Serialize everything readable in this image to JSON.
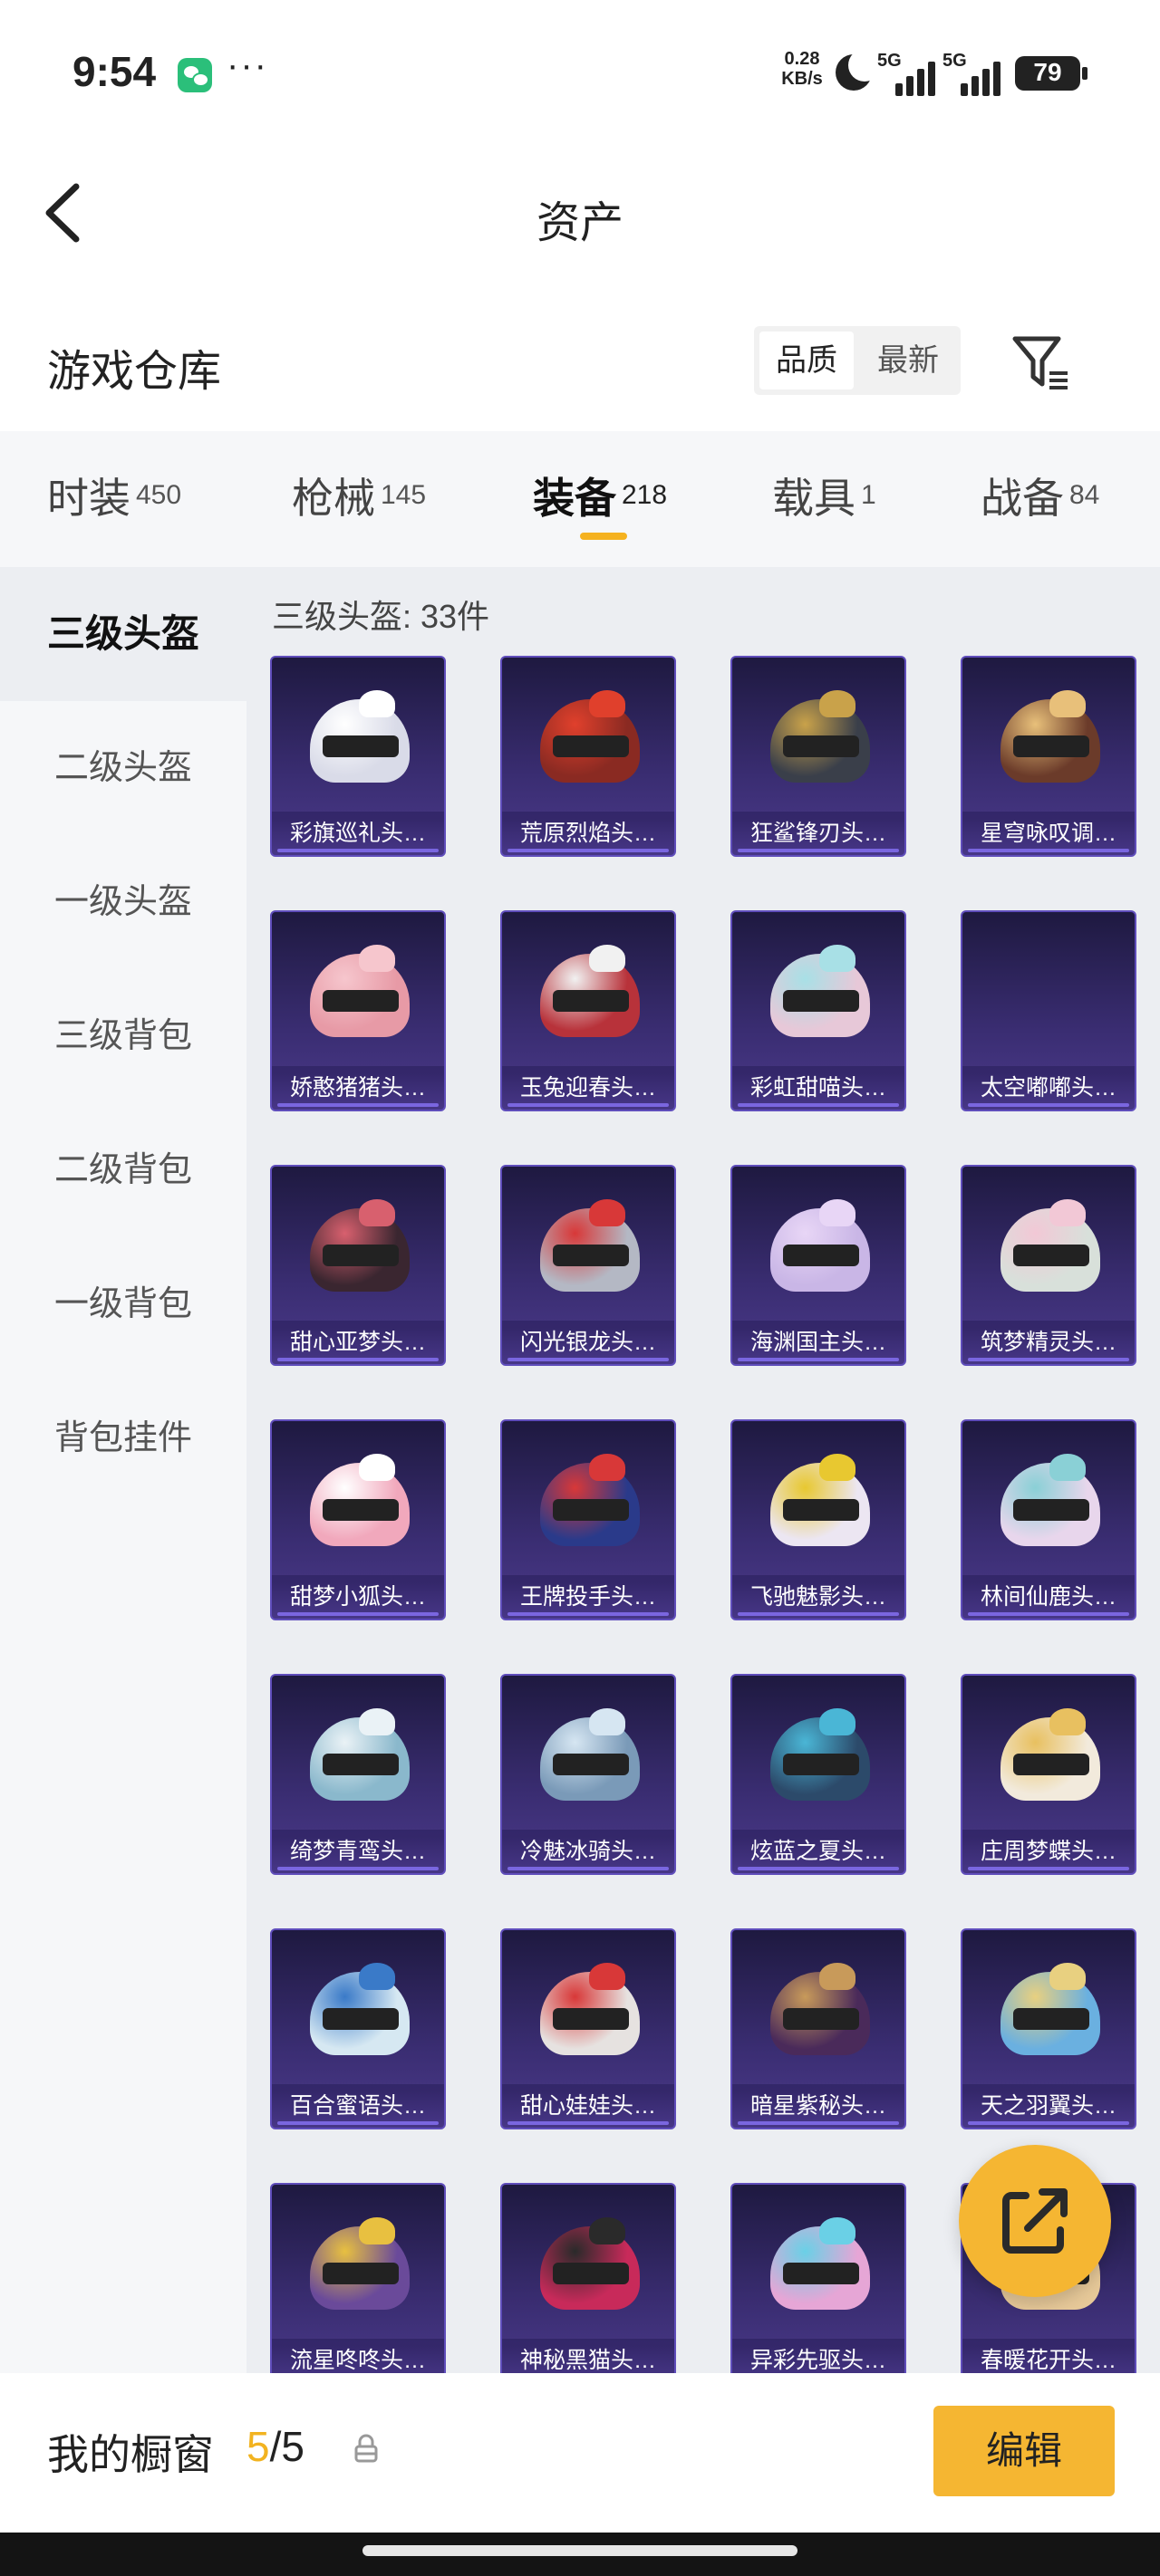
{
  "status_bar": {
    "time": "9:54",
    "more": "···",
    "net_speed_value": "0.28",
    "net_speed_unit": "KB/s",
    "signal1": "5G",
    "signal2": "5G",
    "battery": "79"
  },
  "nav": {
    "title": "资产"
  },
  "header": {
    "title": "游戏仓库",
    "sort_options": [
      "品质",
      "最新"
    ],
    "active_sort": "品质"
  },
  "tabs": [
    {
      "label": "时装",
      "count": "450"
    },
    {
      "label": "枪械",
      "count": "145"
    },
    {
      "label": "装备",
      "count": "218"
    },
    {
      "label": "载具",
      "count": "1"
    },
    {
      "label": "战备",
      "count": "84"
    }
  ],
  "active_tab": "装备",
  "sidebar": [
    {
      "label": "三级头盔"
    },
    {
      "label": "二级头盔"
    },
    {
      "label": "一级头盔"
    },
    {
      "label": "三级背包"
    },
    {
      "label": "二级背包"
    },
    {
      "label": "一级背包"
    },
    {
      "label": "背包挂件"
    }
  ],
  "category_count": "三级头盔: 33件",
  "items": [
    {
      "name": "彩旗巡礼头…",
      "color": "#d9dbe8",
      "accent": "#ffffff"
    },
    {
      "name": "荒原烈焰头…",
      "color": "#8a2a22",
      "accent": "#e0402c"
    },
    {
      "name": "狂鲨锋刃头…",
      "color": "#3a3f4a",
      "accent": "#c9a24a"
    },
    {
      "name": "星穹咏叹调…",
      "color": "#6b3b2a",
      "accent": "#e8c07a"
    },
    {
      "name": "娇憨猪猪头…",
      "color": "#e79aa6",
      "accent": "#f6c6cd"
    },
    {
      "name": "玉兔迎春头…",
      "color": "#b8323a",
      "accent": "#f1f1f1"
    },
    {
      "name": "彩虹甜喵头…",
      "color": "#e7c8d8",
      "accent": "#a8e0e6"
    },
    {
      "name": "太空嘟嘟头…",
      "color": "#2a2550",
      "accent": "#2a2550"
    },
    {
      "name": "甜心亚梦头…",
      "color": "#3a2630",
      "accent": "#d8606e"
    },
    {
      "name": "闪光银龙头…",
      "color": "#b4b8c4",
      "accent": "#d83838"
    },
    {
      "name": "海渊国主头…",
      "color": "#c9b6e6",
      "accent": "#e8d6f6"
    },
    {
      "name": "筑梦精灵头…",
      "color": "#d8e0da",
      "accent": "#f2c8d6"
    },
    {
      "name": "甜梦小狐头…",
      "color": "#f1a8bc",
      "accent": "#ffffff"
    },
    {
      "name": "王牌投手头…",
      "color": "#2a3a8a",
      "accent": "#d83838"
    },
    {
      "name": "飞驰魅影头…",
      "color": "#ece6f2",
      "accent": "#e8c830"
    },
    {
      "name": "林间仙鹿头…",
      "color": "#e8d6ec",
      "accent": "#8ad0d6"
    },
    {
      "name": "绮梦青鸾头…",
      "color": "#8ab8cc",
      "accent": "#eaf2f6"
    },
    {
      "name": "冷魅冰骑头…",
      "color": "#7a9ab8",
      "accent": "#d6e6f2"
    },
    {
      "name": "炫蓝之夏头…",
      "color": "#2c4a6a",
      "accent": "#4ab6d6"
    },
    {
      "name": "庄周梦蝶头…",
      "color": "#f2eadc",
      "accent": "#e8c060"
    },
    {
      "name": "百合蜜语头…",
      "color": "#d6e8f2",
      "accent": "#3a7ac8"
    },
    {
      "name": "甜心娃娃头…",
      "color": "#e6e2e0",
      "accent": "#d83838"
    },
    {
      "name": "暗星紫秘头…",
      "color": "#4a2a5a",
      "accent": "#c89a5a"
    },
    {
      "name": "天之羽翼头…",
      "color": "#6ab0e0",
      "accent": "#e8d080"
    },
    {
      "name": "流星咚咚头…",
      "color": "#6a4a9a",
      "accent": "#e8c040"
    },
    {
      "name": "神秘黑猫头…",
      "color": "#c82a5a",
      "accent": "#2a2a2a"
    },
    {
      "name": "异彩先驱头…",
      "color": "#e6a6d6",
      "accent": "#6ad0e6"
    },
    {
      "name": "春暖花开头…",
      "color": "#e6c898",
      "accent": "#f6e6c8"
    }
  ],
  "bottom": {
    "showcase_label": "我的橱窗",
    "current": "5",
    "separator": "/",
    "total": "5",
    "edit_label": "编辑"
  },
  "colors": {
    "accent": "#f5b632",
    "card_border": "#5f4dbb"
  }
}
